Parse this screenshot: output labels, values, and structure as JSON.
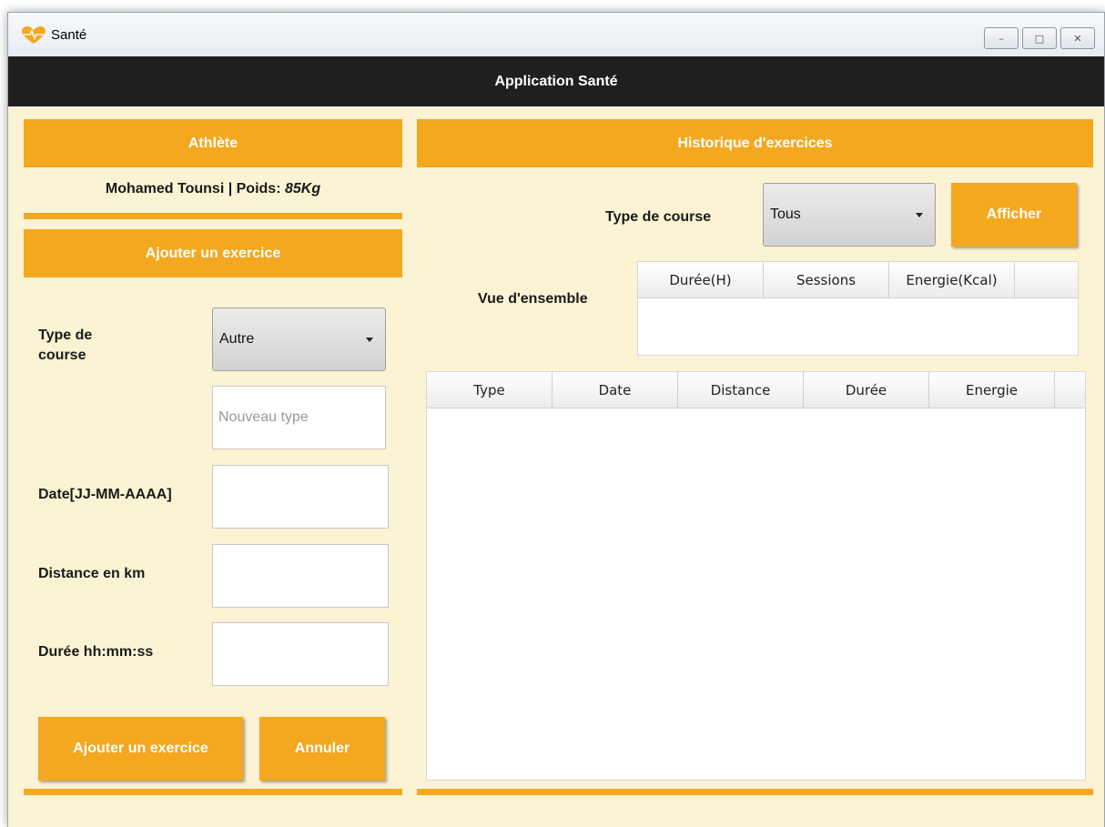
{
  "window": {
    "title": "Santé",
    "controls": {
      "minimize": "–",
      "maximize": "□",
      "close": "✕"
    }
  },
  "header": {
    "title": "Application Santé"
  },
  "athlete": {
    "heading": "Athlète",
    "name": "Mohamed Tounsi | Poids: ",
    "weight": "85Kg"
  },
  "add_form": {
    "heading": "Ajouter un exercice",
    "type_label": "Type de course",
    "type_value": "Autre",
    "new_type_placeholder": "Nouveau type",
    "date_label": "Date[JJ-MM-AAAA]",
    "distance_label": "Distance en km",
    "duration_label": "Durée hh:mm:ss",
    "submit_label": "Ajouter un exercice",
    "cancel_label": "Annuler"
  },
  "history": {
    "heading": "Historique d'exercices",
    "filter_label": "Type de course",
    "filter_value": "Tous",
    "show_label": "Afficher",
    "overview_label": "Vue d'ensemble",
    "overview_columns": [
      "Durée(H)",
      "Sessions",
      "Energie(Kcal)"
    ],
    "columns": [
      "Type",
      "Date",
      "Distance",
      "Durée",
      "Energie"
    ]
  },
  "colors": {
    "accent": "#f4a81f",
    "background": "#fbf3d3",
    "header": "#1f1f21"
  }
}
